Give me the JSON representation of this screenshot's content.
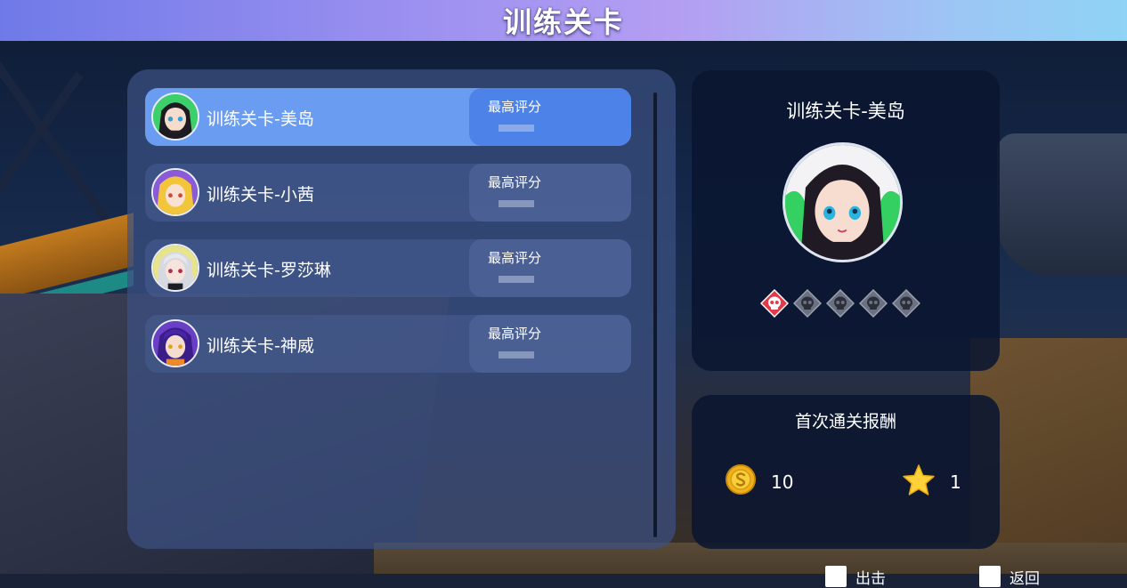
{
  "title": "训练关卡",
  "levels": [
    {
      "name": "训练关卡-美岛",
      "score_label": "最高评分",
      "selected": true,
      "avatar": "meidao-avatar"
    },
    {
      "name": "训练关卡-小茜",
      "score_label": "最高评分",
      "selected": false,
      "avatar": "xiaoqian-avatar"
    },
    {
      "name": "训练关卡-罗莎琳",
      "score_label": "最高评分",
      "selected": false,
      "avatar": "rosalyn-avatar"
    },
    {
      "name": "训练关卡-神威",
      "score_label": "最高评分",
      "selected": false,
      "avatar": "shenwei-avatar"
    }
  ],
  "detail": {
    "title": "训练关卡-美岛",
    "difficulty": {
      "active": 1,
      "total": 5,
      "active_color": "#e23a4a",
      "inactive_color": "#6b7180"
    }
  },
  "reward": {
    "title": "首次通关报酬",
    "coin_icon": "gold-coin-icon",
    "coin_value": "10",
    "star_icon": "star-icon",
    "star_value": "1"
  },
  "hints": [
    {
      "key": "white-key-icon",
      "label": "出击"
    },
    {
      "key": "white-key-icon",
      "label": "返回"
    }
  ],
  "colors": {
    "title_gradient_start": "#6f7ae8",
    "title_gradient_end": "#8fd3f6",
    "selected_row": "#6a9cf2",
    "panel_dark": "#0a1630"
  }
}
